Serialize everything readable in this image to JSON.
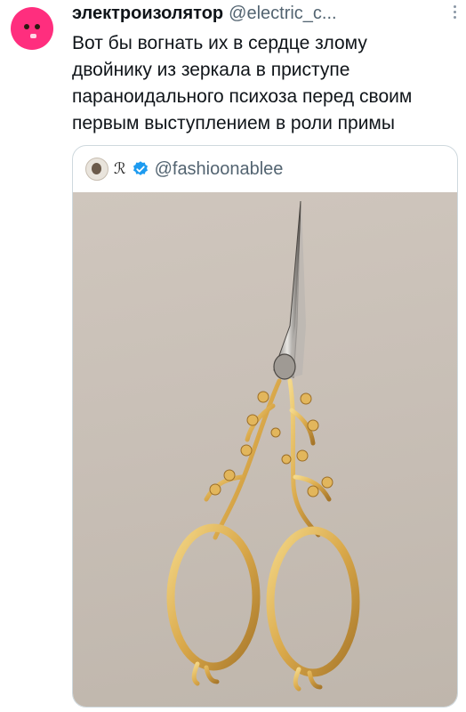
{
  "tweet": {
    "display_name": "электроизолятор",
    "handle": "@electric_c...",
    "text": "Вот бы вогнать их в сердце злому\nдвойнику из зеркала в приступе\nпараноидального психоза перед своим\nпервым выступлением в роли примы"
  },
  "quote": {
    "emoji": "ℛ",
    "handle": "@fashioonablee",
    "verified_color": "#1d9bf0"
  },
  "icons": {
    "avatar": "pink-face-avatar",
    "more": "more-options-icon",
    "verified": "verified-badge-icon"
  }
}
